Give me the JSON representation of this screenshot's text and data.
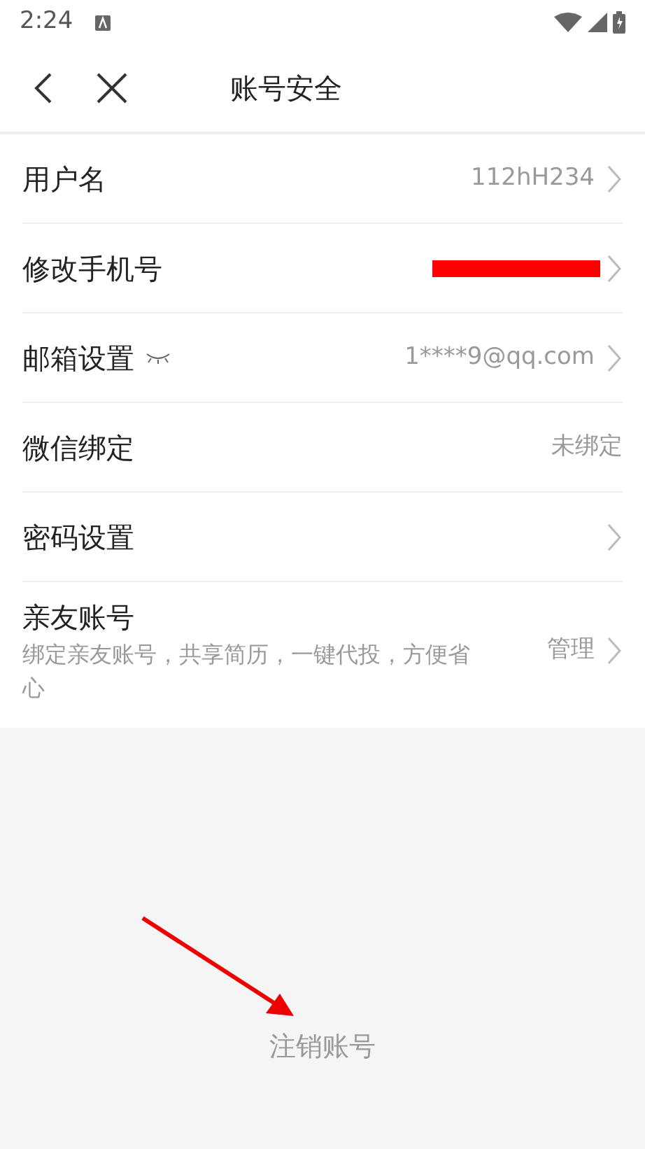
{
  "status_bar": {
    "time": "2:24"
  },
  "header": {
    "title": "账号安全"
  },
  "rows": [
    {
      "label": "用户名",
      "value": "112hH234",
      "chevron": true
    },
    {
      "label": "修改手机号",
      "redacted": true,
      "chevron": true
    },
    {
      "label": "邮箱设置",
      "eye_icon": true,
      "value": "1****9@qq.com",
      "chevron": true
    },
    {
      "label": "微信绑定",
      "value": "未绑定",
      "chevron": false
    },
    {
      "label": "密码设置",
      "chevron": true
    },
    {
      "label": "亲友账号",
      "subtitle": "绑定亲友账号，共享简历，一键代投，方便省心",
      "value": "管理",
      "chevron": true
    }
  ],
  "footer": {
    "action": "注销账号"
  },
  "annotation": {
    "kind": "arrow"
  }
}
